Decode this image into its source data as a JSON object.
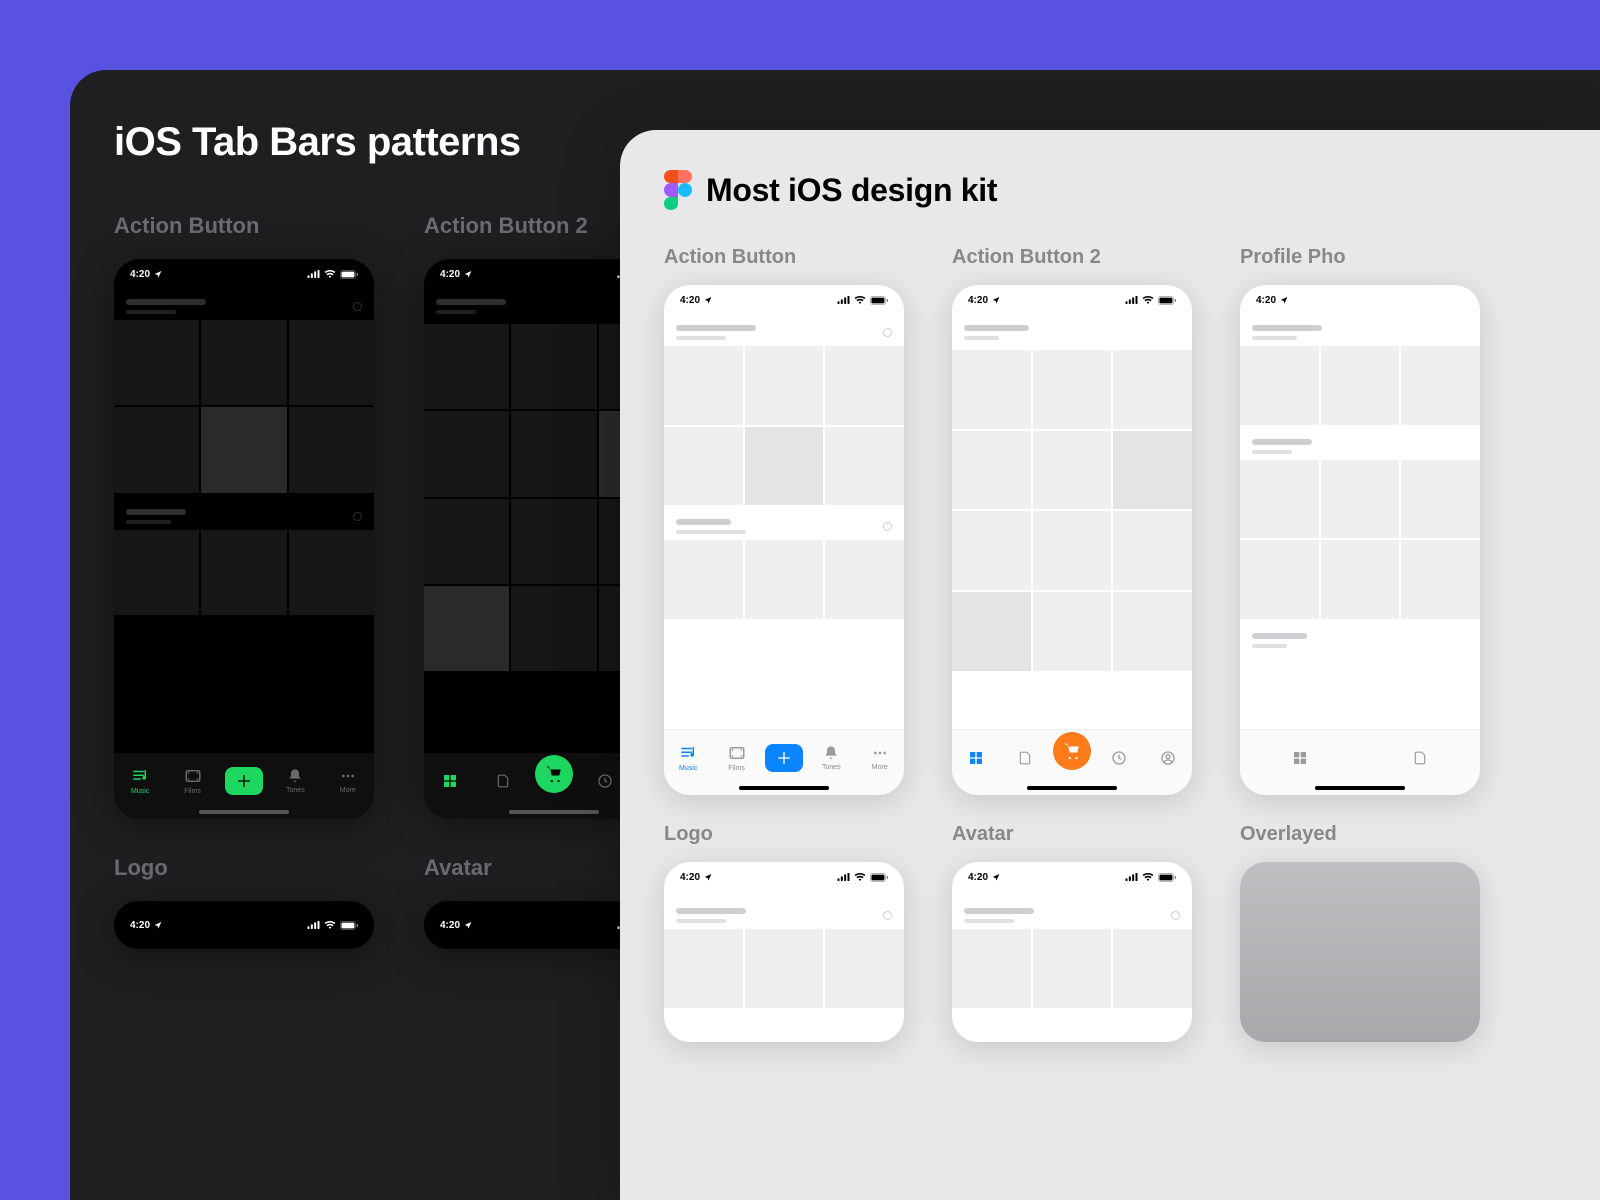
{
  "dark": {
    "title": "iOS Tab Bars patterns",
    "labels": {
      "a1": "Action Button",
      "a2": "Action Button 2",
      "logo": "Logo",
      "avatar": "Avatar"
    },
    "time": "4:20",
    "tabs1": [
      "Music",
      "Films",
      "",
      "Tones",
      "More"
    ]
  },
  "light": {
    "title": "Most iOS design kit",
    "labels": {
      "a1": "Action Button",
      "a2": "Action Button 2",
      "profile": "Profile Pho",
      "logo": "Logo",
      "avatar": "Avatar",
      "overlay": "Overlayed"
    },
    "time": "4:20",
    "tabs1": [
      "Music",
      "Films",
      "",
      "Tones",
      "More"
    ]
  },
  "colors": {
    "spotifyGreen": "#1ed760",
    "iosBlue": "#0a84ff",
    "orange": "#ff7a18"
  }
}
